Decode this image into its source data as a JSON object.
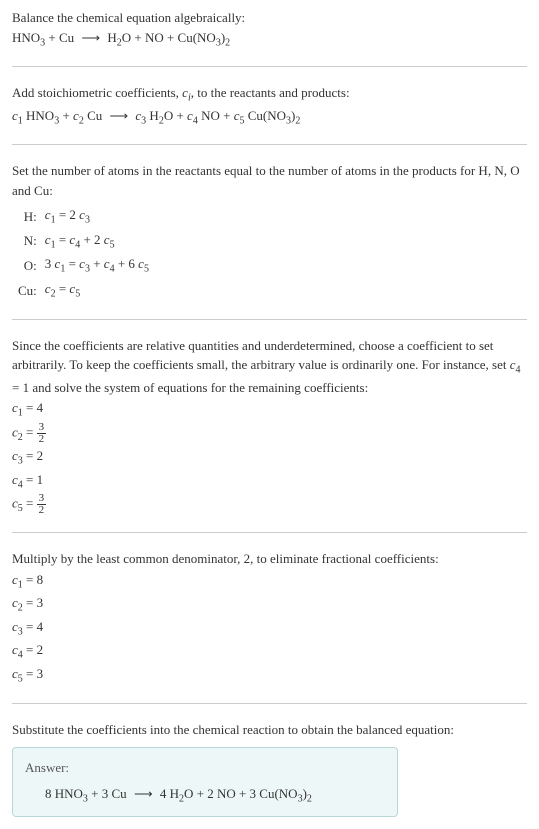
{
  "intro": {
    "line1": "Balance the chemical equation algebraically:",
    "eq_left": "HNO",
    "eq_left_sub": "3",
    "eq_plus": " + Cu ",
    "arrow": "⟶",
    "eq_right_h2o": " H",
    "eq_right_h2o_sub": "2",
    "eq_right_o": "O + NO + Cu(NO",
    "eq_right_no3_sub": "3",
    "eq_right_close": ")",
    "eq_right_close_sub": "2"
  },
  "stoich": {
    "line1": "Add stoichiometric coefficients, ",
    "ci": "c",
    "ci_sub": "i",
    "line1b": ", to the reactants and products:",
    "c1": "c",
    "c1_sub": "1",
    "hno3_h": " HNO",
    "hno3_sub": "3",
    "plus1": " + ",
    "c2": "c",
    "c2_sub": "2",
    "cu": " Cu ",
    "arrow": "⟶",
    "c3": " c",
    "c3_sub": "3",
    "h2o_h": " H",
    "h2o_sub": "2",
    "h2o_o": "O + ",
    "c4": "c",
    "c4_sub": "4",
    "no": " NO + ",
    "c5": "c",
    "c5_sub": "5",
    "cuno3_cu": " Cu(NO",
    "cuno3_sub1": "3",
    "cuno3_close": ")",
    "cuno3_sub2": "2"
  },
  "atoms": {
    "line1": "Set the number of atoms in the reactants equal to the number of atoms in the products for H, N, O and Cu:",
    "rows": [
      {
        "label": "H:",
        "eq_parts": [
          "c",
          "1",
          " = 2 ",
          "c",
          "3"
        ]
      },
      {
        "label": "N:",
        "eq_parts": [
          "c",
          "1",
          " = ",
          "c",
          "4",
          " + 2 ",
          "c",
          "5"
        ]
      },
      {
        "label": "O:",
        "eq_parts": [
          "3 ",
          "c",
          "1",
          " = ",
          "c",
          "3",
          " + ",
          "c",
          "4",
          " + 6 ",
          "c",
          "5"
        ]
      },
      {
        "label": "Cu:",
        "eq_parts": [
          "c",
          "2",
          " = ",
          "c",
          "5"
        ]
      }
    ]
  },
  "underdet": {
    "text": "Since the coefficients are relative quantities and underdetermined, choose a coefficient to set arbitrarily. To keep the coefficients small, the arbitrary value is ordinarily one. For instance, set ",
    "c4": "c",
    "c4_sub": "4",
    "text2": " = 1 and solve the system of equations for the remaining coefficients:",
    "coefs": [
      {
        "c": "c",
        "sub": "1",
        "eq": " = 4"
      },
      {
        "c": "c",
        "sub": "2",
        "eq": " = ",
        "frac_num": "3",
        "frac_den": "2"
      },
      {
        "c": "c",
        "sub": "3",
        "eq": " = 2"
      },
      {
        "c": "c",
        "sub": "4",
        "eq": " = 1"
      },
      {
        "c": "c",
        "sub": "5",
        "eq": " = ",
        "frac_num": "3",
        "frac_den": "2"
      }
    ]
  },
  "lcd": {
    "text": "Multiply by the least common denominator, 2, to eliminate fractional coefficients:",
    "coefs": [
      {
        "c": "c",
        "sub": "1",
        "eq": " = 8"
      },
      {
        "c": "c",
        "sub": "2",
        "eq": " = 3"
      },
      {
        "c": "c",
        "sub": "3",
        "eq": " = 4"
      },
      {
        "c": "c",
        "sub": "4",
        "eq": " = 2"
      },
      {
        "c": "c",
        "sub": "5",
        "eq": " = 3"
      }
    ]
  },
  "final": {
    "text": "Substitute the coefficients into the chemical reaction to obtain the balanced equation:",
    "answer_label": "Answer:",
    "eq": {
      "n1": "8 HNO",
      "sub1": "3",
      "plus1": " + 3 Cu ",
      "arrow": "⟶",
      "n2": " 4 H",
      "sub2": "2",
      "n3": "O + 2 NO + 3 Cu(NO",
      "sub3": "3",
      "n4": ")",
      "sub4": "2"
    }
  }
}
